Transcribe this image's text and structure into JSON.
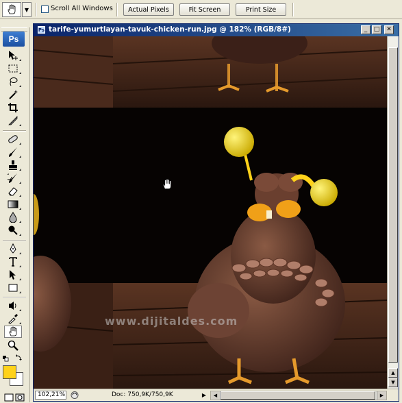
{
  "options_bar": {
    "scroll_all_windows_label": "Scroll All Windows",
    "scroll_all_windows_checked": false,
    "actual_pixels_label": "Actual Pixels",
    "fit_screen_label": "Fit Screen",
    "print_size_label": "Print Size"
  },
  "toolbox": {
    "logo": "Ps",
    "tools": [
      "move-tool-icon",
      "marquee-tool-icon",
      "lasso-tool-icon",
      "magic-wand-icon",
      "crop-tool-icon",
      "slice-tool-icon",
      "healing-brush-icon",
      "brush-tool-icon",
      "clone-stamp-icon",
      "history-brush-icon",
      "eraser-icon",
      "gradient-icon",
      "blur-icon",
      "dodge-icon",
      "pen-tool-icon",
      "type-tool-icon",
      "path-selection-icon",
      "shape-tool-icon",
      "notes-icon",
      "eyedropper-icon",
      "hand-tool-icon",
      "zoom-tool-icon"
    ],
    "active_tool": "hand-tool-icon",
    "foreground_color": "#ffd21a",
    "background_color": "#ffffff"
  },
  "document": {
    "title": "tarife-yumurtlayan-tavuk-chicken-run.jpg @ 182% (RGB/8#)",
    "watermark": "www.dijitaldes.com",
    "accent_color": "#0a246a"
  },
  "status_bar": {
    "zoom": "102,21%",
    "doc_info": "Doc: 750,9K/750,9K"
  }
}
